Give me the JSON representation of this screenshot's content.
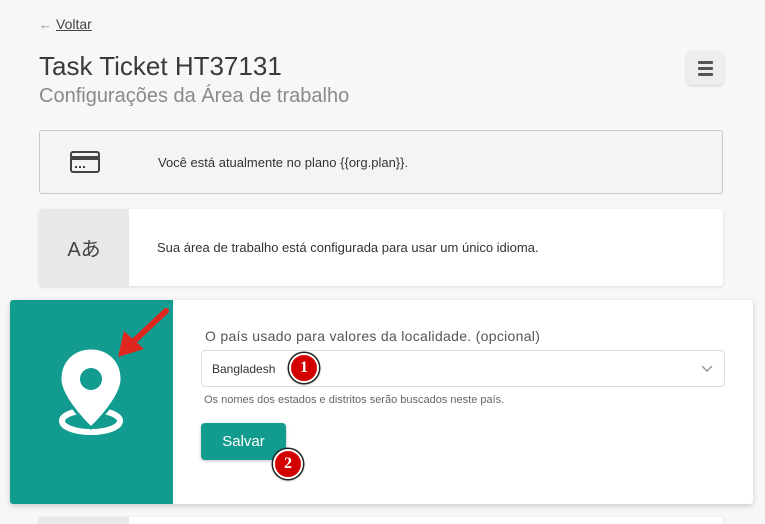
{
  "nav": {
    "back_arrow": "←",
    "back_label": "Voltar"
  },
  "header": {
    "title": "Task Ticket HT37131",
    "subtitle": "Configurações da Área de trabalho"
  },
  "plan_card": {
    "icon": "credit-card-icon",
    "text": "Você está atualmente no plano {{org.plan}}."
  },
  "language_card": {
    "icon": "translate-icon",
    "icon_text": "Aあ",
    "text": "Sua área de trabalho está configurada para usar um único idioma."
  },
  "country_card": {
    "icon": "location-pin-icon",
    "label": "O país usado para valores da localidade. (opcional)",
    "selected_country": "Bangladesh",
    "help_text": "Os nomes dos estados e distritos serão buscados neste país.",
    "save_label": "Salvar"
  },
  "annotations": {
    "badge_1": "1",
    "badge_2": "2"
  },
  "colors": {
    "accent": "#129c8f",
    "annotation_red": "#d40000"
  }
}
